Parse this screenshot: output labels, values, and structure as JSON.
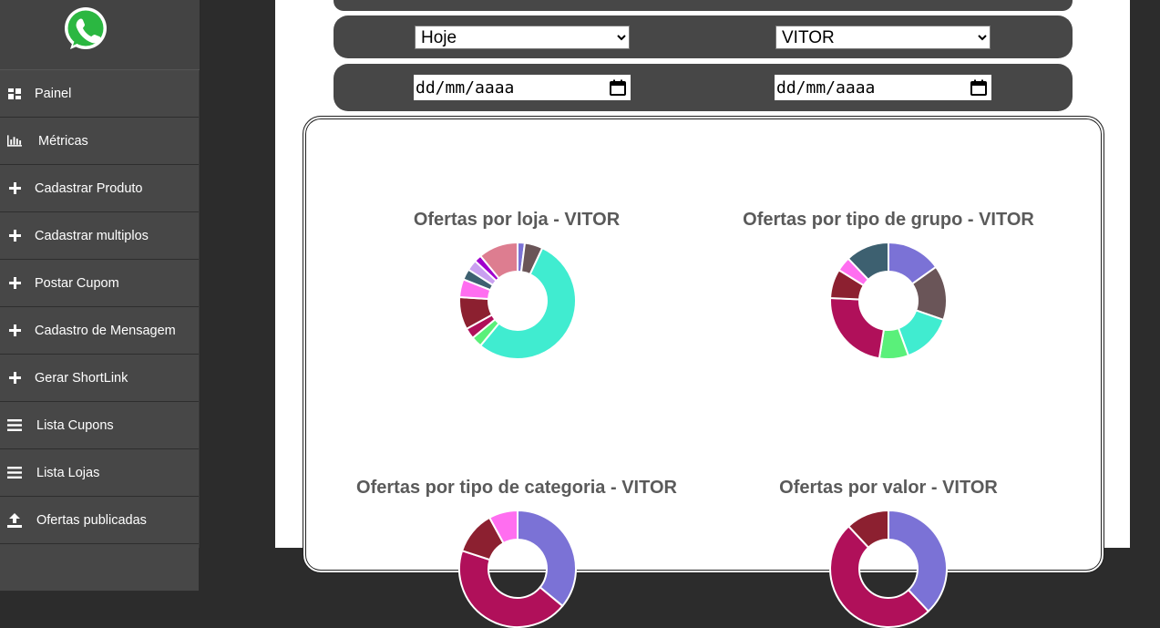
{
  "sidebar": {
    "logo": "whatsapp-logo",
    "items": [
      {
        "label": "Painel",
        "icon": "dashboard-icon"
      },
      {
        "label": "Métricas",
        "icon": "bar-chart-icon"
      },
      {
        "label": "Cadastrar Produto",
        "icon": "plus-icon"
      },
      {
        "label": "Cadastrar multiplos",
        "icon": "plus-icon"
      },
      {
        "label": "Postar Cupom",
        "icon": "plus-icon"
      },
      {
        "label": "Cadastro de Mensagem",
        "icon": "plus-icon"
      },
      {
        "label": "Gerar ShortLink",
        "icon": "plus-icon"
      },
      {
        "label": "Lista Cupons",
        "icon": "list-icon"
      },
      {
        "label": "Lista Lojas",
        "icon": "list-icon"
      },
      {
        "label": "Ofertas publicadas",
        "icon": "upload-icon"
      }
    ]
  },
  "filters": {
    "period": {
      "selected": "Hoje"
    },
    "user": {
      "selected": "VITOR"
    },
    "date_start": {
      "placeholder": "dd/mm/aaaa"
    },
    "date_end": {
      "placeholder": "dd/mm/aaaa"
    }
  },
  "chart_data": [
    {
      "type": "pie",
      "title": "Ofertas por loja - VITOR",
      "donut": true,
      "slices": [
        {
          "value": 2,
          "color": "#7b72d6"
        },
        {
          "value": 5,
          "color": "#6a5558"
        },
        {
          "value": 54,
          "color": "#40ecd0"
        },
        {
          "value": 3,
          "color": "#5af07a"
        },
        {
          "value": 3,
          "color": "#b0105a"
        },
        {
          "value": 9,
          "color": "#8c2030"
        },
        {
          "value": 5,
          "color": "#ff6ef0"
        },
        {
          "value": 3,
          "color": "#3d6070"
        },
        {
          "value": 3,
          "color": "#c9a0f0"
        },
        {
          "value": 2,
          "color": "#a000cc"
        },
        {
          "value": 11,
          "color": "#dd7d90"
        }
      ]
    },
    {
      "type": "pie",
      "title": "Ofertas por tipo de grupo - VITOR",
      "donut": true,
      "slices": [
        {
          "value": 15,
          "color": "#7b72d6"
        },
        {
          "value": 15,
          "color": "#6a5558"
        },
        {
          "value": 14,
          "color": "#40ecd0"
        },
        {
          "value": 8,
          "color": "#5af07a"
        },
        {
          "value": 23,
          "color": "#b0105a"
        },
        {
          "value": 8,
          "color": "#8c2030"
        },
        {
          "value": 4,
          "color": "#ff6ef0"
        },
        {
          "value": 12,
          "color": "#3d6070"
        }
      ]
    },
    {
      "type": "pie",
      "title": "Ofertas por tipo de categoria - VITOR",
      "donut": true,
      "slices": [
        {
          "value": 36,
          "color": "#7b72d6"
        },
        {
          "value": 44,
          "color": "#b0105a"
        },
        {
          "value": 12,
          "color": "#8c2030"
        },
        {
          "value": 8,
          "color": "#ff6ef0"
        }
      ]
    },
    {
      "type": "pie",
      "title": "Ofertas por valor - VITOR",
      "donut": true,
      "slices": [
        {
          "value": 38,
          "color": "#7b72d6"
        },
        {
          "value": 50,
          "color": "#b0105a"
        },
        {
          "value": 12,
          "color": "#8c2030"
        }
      ]
    }
  ]
}
